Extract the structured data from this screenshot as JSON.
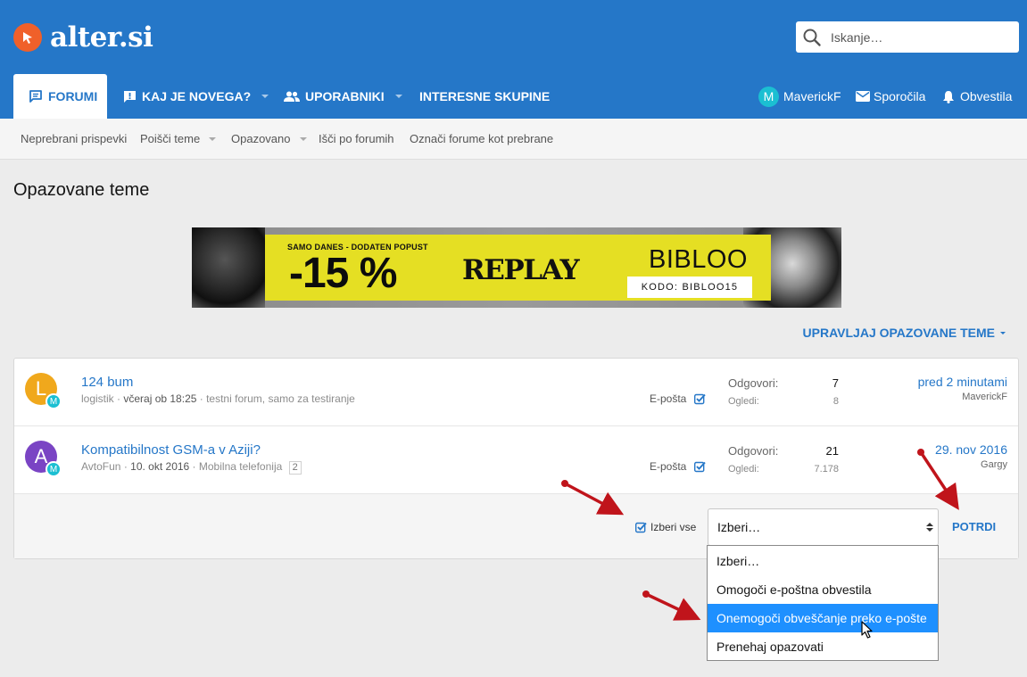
{
  "header": {
    "logo_text": "alter.si",
    "search_placeholder": "Iskanje…",
    "brand_color": "#2577c8",
    "logo_color": "#f0602a"
  },
  "nav": {
    "tabs": [
      {
        "label": "FORUMI",
        "icon": "forum-icon",
        "active": true
      },
      {
        "label": "KAJ JE NOVEGA?",
        "icon": "new-alert-icon"
      },
      {
        "label": "UPORABNIKI",
        "icon": "users-icon"
      },
      {
        "label": "INTERESNE SKUPINE"
      }
    ],
    "user": {
      "avatar_letter": "M",
      "name": "MaverickF"
    },
    "messages_label": "Sporočila",
    "alerts_label": "Obvestila"
  },
  "subnav": {
    "items": [
      "Neprebrani prispevki",
      "Poišči teme",
      "Opazovano",
      "Išči po forumih",
      "Označi forume kot prebrane"
    ]
  },
  "page": {
    "title": "Opazovane teme",
    "manage_label": "UPRAVLJAJ OPAZOVANE TEME"
  },
  "banner": {
    "small_text": "SAMO DANES - DODATEN POPUST",
    "discount": "-15 %",
    "brand": "REPLAY",
    "shop": "BIBLOO",
    "code": "KODO: BIBLOO15"
  },
  "threads": [
    {
      "avatar_letter": "L",
      "avatar_color": "#f0a81c",
      "mini_avatar_letter": "M",
      "title": "124 bum",
      "author": "logistik",
      "date": "včeraj ob 18:25",
      "forum": "testni forum, samo za testiranje",
      "pages": "",
      "email_label": "E-pošta",
      "replies_label": "Odgovori:",
      "replies": "7",
      "views_label": "Ogledi:",
      "views": "8",
      "last_date": "pred 2 minutami",
      "last_user": "MaverickF"
    },
    {
      "avatar_letter": "A",
      "avatar_color": "#7a44c4",
      "mini_avatar_letter": "M",
      "title": "Kompatibilnost GSM-a v Aziji?",
      "author": "AvtoFun",
      "date": "10. okt 2016",
      "forum": "Mobilna telefonija",
      "pages": "2",
      "email_label": "E-pošta",
      "replies_label": "Odgovori:",
      "replies": "21",
      "views_label": "Ogledi:",
      "views": "7.178",
      "last_date": "29. nov 2016",
      "last_user": "Gargy"
    }
  ],
  "actions": {
    "select_all_label": "Izberi vse",
    "select_value": "Izberi…",
    "confirm_label": "POTRDI",
    "options": [
      "Izberi…",
      "Omogoči e-poštna obvestila",
      "Onemogoči obveščanje preko e-pošte",
      "Prenehaj opazovati"
    ],
    "highlighted_option": "Onemogoči obveščanje preko e-pošte",
    "highlight_color": "#1e90ff",
    "annotation_arrow_color": "#c0141b"
  }
}
